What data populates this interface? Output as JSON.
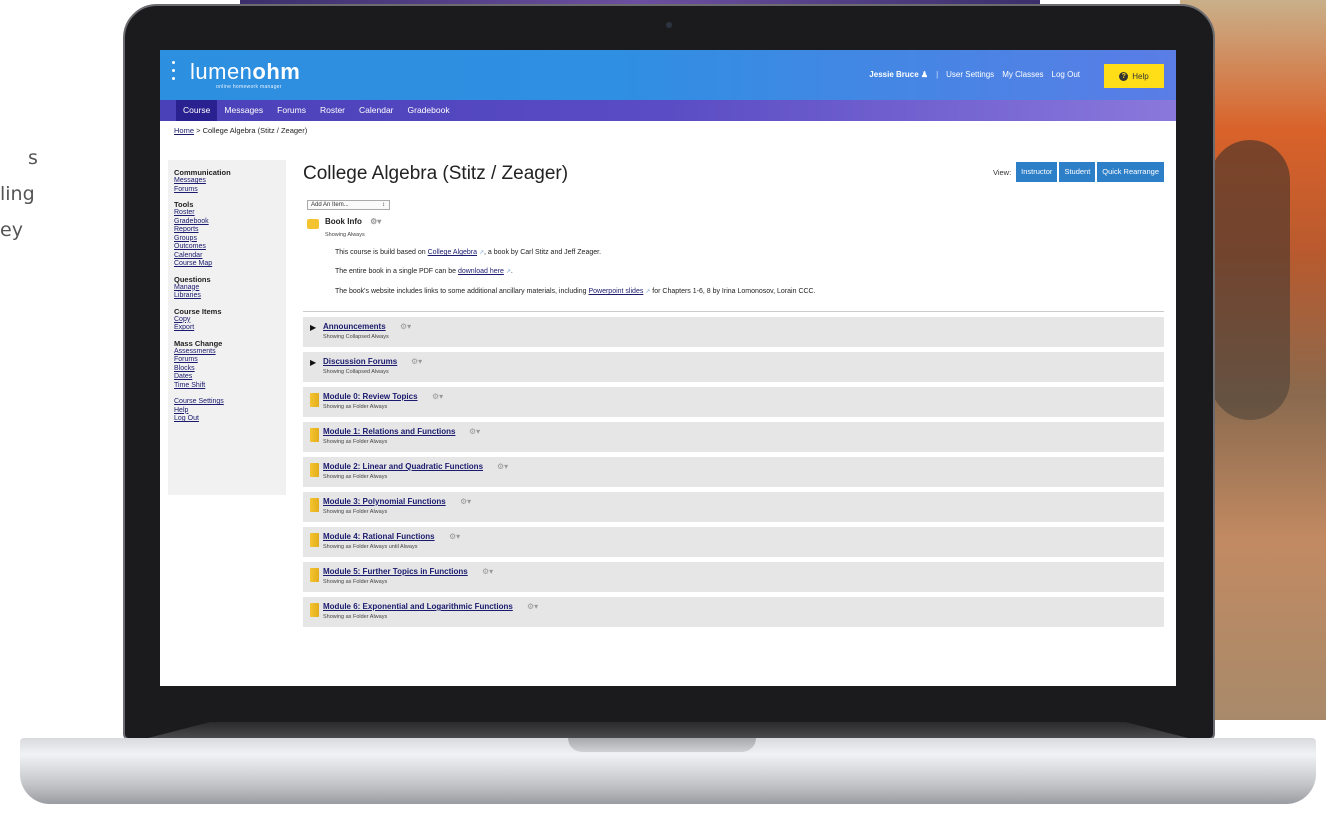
{
  "background": {
    "text_fragments": [
      "s",
      "ling",
      "ey"
    ]
  },
  "app": {
    "logo": {
      "name_light": "lumen",
      "name_bold": "ohm",
      "tagline": "online homework manager"
    },
    "user_nav": {
      "user": "Jessie Bruce",
      "user_icon": "person-icon",
      "items": [
        "User Settings",
        "My Classes",
        "Log Out"
      ],
      "help": "Help"
    },
    "nav_tabs": [
      "Course",
      "Messages",
      "Forums",
      "Roster",
      "Calendar",
      "Gradebook"
    ],
    "active_tab": "Course",
    "breadcrumb": {
      "home": "Home",
      "separator": ">",
      "current": "College Algebra (Stitz / Zeager)"
    }
  },
  "sidebar": {
    "sections": [
      {
        "heading": "Communication",
        "links": [
          "Messages",
          "Forums"
        ]
      },
      {
        "heading": "Tools",
        "links": [
          "Roster",
          "Gradebook",
          "Reports",
          "Groups",
          "Outcomes",
          "Calendar",
          "Course Map"
        ]
      },
      {
        "heading": "Questions",
        "links": [
          "Manage",
          "Libraries"
        ]
      },
      {
        "heading": "Course Items",
        "links": [
          "Copy",
          "Export"
        ]
      },
      {
        "heading": "Mass Change",
        "links": [
          "Assessments",
          "Forums",
          "Blocks",
          "Dates",
          "Time Shift"
        ]
      },
      {
        "heading": "",
        "links": [
          "Course Settings",
          "Help",
          "Log Out"
        ]
      }
    ]
  },
  "main": {
    "title": "College Algebra (Stitz / Zeager)",
    "view": {
      "label": "View:",
      "buttons": [
        "Instructor",
        "Student",
        "Quick Rearrange"
      ]
    },
    "add_item": "Add An Item...",
    "book_info": {
      "title": "Book Info",
      "status": "Showing Always",
      "line1": {
        "before": "This course is build based on ",
        "link": "College Algebra",
        "after": ", a book by Carl Stitz and Jeff Zeager."
      },
      "line2": {
        "before": "The entire book in a single PDF can be ",
        "link": "download here",
        "after": "."
      },
      "line3": {
        "before": "The book's website includes links to some additional ancillary materials, including ",
        "link": "Powerpoint slides",
        "after": " for Chapters 1-6, 8 by Irina Lomonosov, Lorain CCC."
      }
    },
    "blocks": [
      {
        "title": "Announcements",
        "status": "Showing Collapsed Always",
        "kind": "collapsed"
      },
      {
        "title": "Discussion Forums",
        "status": "Showing Collapsed Always",
        "kind": "collapsed"
      },
      {
        "title": "Module 0: Review Topics",
        "status": "Showing as Folder Always",
        "kind": "folder"
      },
      {
        "title": "Module 1: Relations and Functions",
        "status": "Showing as Folder Always",
        "kind": "folder"
      },
      {
        "title": "Module 2: Linear and Quadratic Functions",
        "status": "Showing as Folder Always",
        "kind": "folder"
      },
      {
        "title": "Module 3: Polynomial Functions",
        "status": "Showing as Folder Always",
        "kind": "folder"
      },
      {
        "title": "Module 4: Rational Functions",
        "status": "Showing as Folder Always until Always",
        "kind": "folder"
      },
      {
        "title": "Module 5: Further Topics in Functions",
        "status": "Showing as Folder Always",
        "kind": "folder"
      },
      {
        "title": "Module 6: Exponential and Logarithmic Functions",
        "status": "Showing as Folder Always",
        "kind": "folder"
      }
    ]
  },
  "colors": {
    "topbar": "#2d8fe0",
    "navbar": "#4a40b8",
    "help": "#ffde17",
    "view_button": "#2d7fc8"
  }
}
